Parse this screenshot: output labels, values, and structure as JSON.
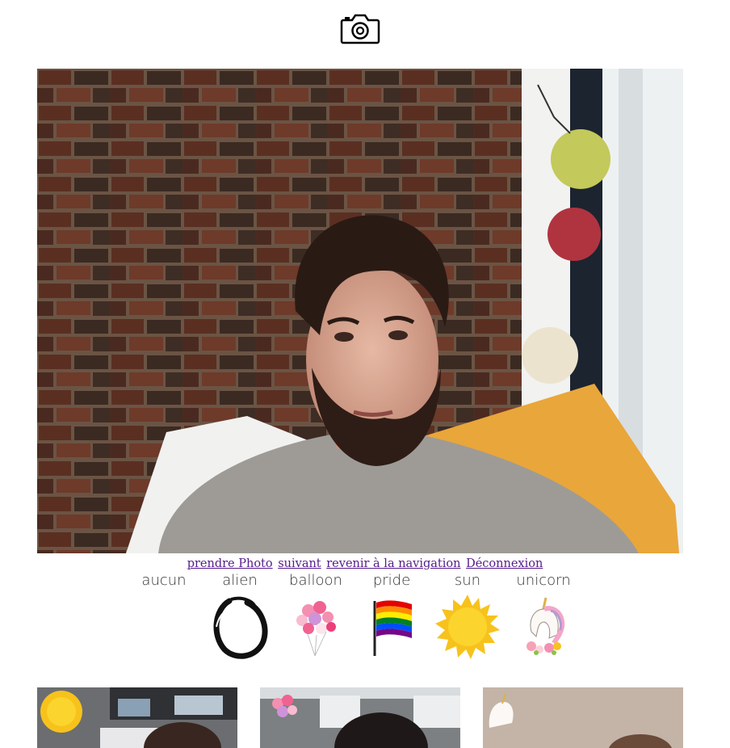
{
  "header": {
    "logo_icon": "camera-icon"
  },
  "webcam": {
    "description_icon": "webcam-preview"
  },
  "nav": {
    "take_photo": "prendre Photo",
    "next": "suivant",
    "back_to_nav": "revenir à la navigation",
    "logout": "Déconnexion"
  },
  "filters": [
    {
      "label": "aucun",
      "icon": "none"
    },
    {
      "label": "alien",
      "icon": "alien-ring-icon"
    },
    {
      "label": "balloon",
      "icon": "balloon-icon"
    },
    {
      "label": "pride",
      "icon": "pride-flag-icon"
    },
    {
      "label": "sun",
      "icon": "sun-icon"
    },
    {
      "label": "unicorn",
      "icon": "unicorn-icon"
    }
  ],
  "gallery": [
    {
      "overlay": "sun-icon"
    },
    {
      "overlay": "balloon-icon"
    },
    {
      "overlay": "unicorn-icon"
    }
  ],
  "colors": {
    "link": "#551a8b",
    "sun": "#f7c21b"
  }
}
